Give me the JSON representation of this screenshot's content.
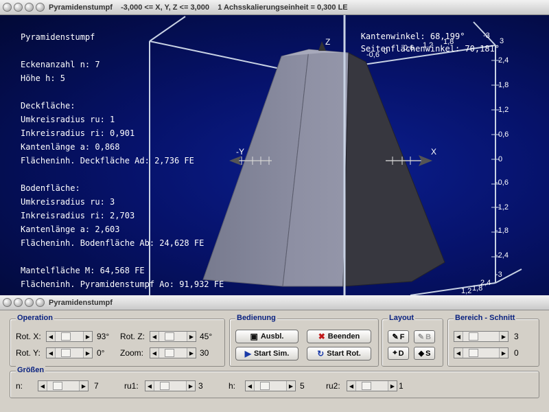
{
  "window": {
    "title": "Pyramidenstumpf    -3,000 <= X, Y, Z <= 3,000    1 Achsskalierungseinheit = 0,300 LE"
  },
  "info": {
    "heading": "Pyramidenstumpf",
    "ecken": "Eckenanzahl n: 7",
    "hoehe": "Höhe h: 5",
    "deck_heading": "Deckfläche:",
    "deck_ru": "Umkreisradius ru: 1",
    "deck_ri": "Inkreisradius ri: 0,901",
    "deck_a": "Kantenlänge a: 0,868",
    "deck_area": "Flächeninh. Deckfläche Ad: 2,736 FE",
    "boden_heading": "Bodenfläche:",
    "boden_ru": "Umkreisradius ru: 3",
    "boden_ri": "Inkreisradius ri: 2,703",
    "boden_a": "Kantenlänge a: 2,603",
    "boden_area": "Flächeninh. Bodenfläche Ab: 24,628 FE",
    "mantel": "Mantelfläche M: 64,568 FE",
    "gesamt": "Flächeninh. Pyramidenstumpf Ao: 91,932 FE"
  },
  "angles": {
    "kanten": "Kantenwinkel: 68,199°",
    "seiten": "Seitenflächenwinkel: 70,181°"
  },
  "axes": {
    "x_label": "X",
    "y_label": "-Y",
    "z_label": "Z",
    "right_ticks": [
      "2,4",
      "1,8",
      "1,2",
      "0,6",
      "0",
      "-0,6",
      "-1,2",
      "-1,8",
      "-2,4",
      "-3"
    ],
    "top_ticks": [
      "-0,6",
      "0",
      "3",
      "1,8",
      "1,2",
      "0,6",
      "-3"
    ],
    "bottom_ticks": [
      "2,4",
      "1,8",
      "1,2"
    ]
  },
  "panel": {
    "title": "Pyramidenstumpf",
    "operation": {
      "label": "Operation",
      "rotx_label": "Rot. X:",
      "rotx_value": "93°",
      "roty_label": "Rot. Y:",
      "roty_value": "0°",
      "rotz_label": "Rot. Z:",
      "rotz_value": "45°",
      "zoom_label": "Zoom:",
      "zoom_value": "30"
    },
    "bedienung": {
      "label": "Bedienung",
      "ausbl": "Ausbl.",
      "beenden": "Beenden",
      "start_sim": "Start Sim.",
      "start_rot": "Start Rot."
    },
    "layout": {
      "label": "Layout",
      "f": "F",
      "b": "B",
      "d": "D",
      "s": "S"
    },
    "bereich": {
      "label": "Bereich - Schnitt",
      "value1": "3",
      "value2": "0"
    },
    "groessen": {
      "label": "Größen",
      "n_label": "n:",
      "n_value": "7",
      "ru1_label": "ru1:",
      "ru1_value": "3",
      "h_label": "h:",
      "h_value": "5",
      "ru2_label": "ru2:",
      "ru2_value": "1"
    }
  },
  "colors": {
    "face_left": "#7d7f92",
    "face_front": "#8a8ca0",
    "face_right": "#383840",
    "bbox": "#c8d2e4",
    "group_label": "#0a2280"
  }
}
